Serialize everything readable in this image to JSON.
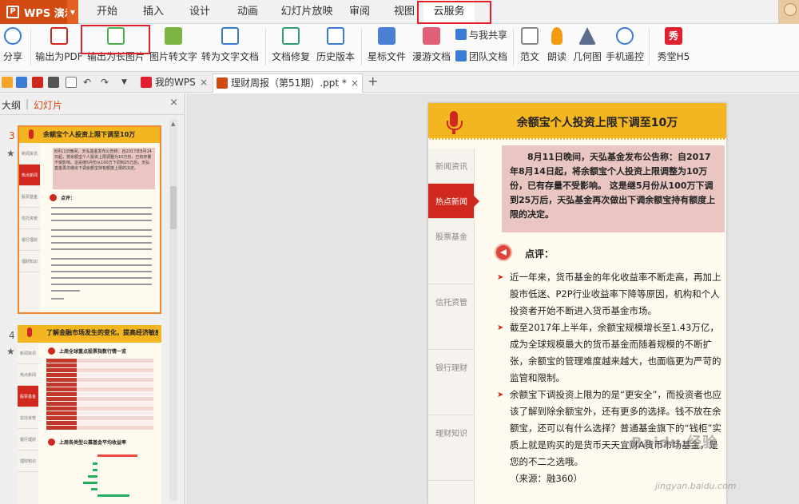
{
  "app": {
    "name": "WPS 演示",
    "logo": "P"
  },
  "menu": [
    "开始",
    "插入",
    "设计",
    "动画",
    "幻灯片放映",
    "审阅",
    "视图",
    "云服务"
  ],
  "ribbon": {
    "share": "分享",
    "export_pdf": "输出为PDF",
    "export_long_image": "输出为长图片",
    "image_to_text": "图片转文字",
    "convert_to_text": "转为文字文档",
    "doc_repair": "文档修复",
    "history": "历史版本",
    "starred": "星标文件",
    "roaming": "漫游文档",
    "share_with_me": "与我共享",
    "team_docs": "团队文档",
    "templates": "范文",
    "read_aloud": "朗读",
    "geometry": "几何图",
    "phone_remote": "手机遥控",
    "xiutang": "秀堂H5",
    "xiutang_logo": "秀"
  },
  "tabs": {
    "my_wps": "我的WPS",
    "doc": "理财周报（第51期）.ppt *",
    "close": "×",
    "add": "+"
  },
  "left_panel": {
    "outline_tab": "大纲",
    "slides_tab": "幻灯片",
    "divider": "|",
    "close": "×",
    "slide3_num": "3",
    "slide4_num": "4",
    "star": "★",
    "thumb3": {
      "title": "余额宝个人投资上限下调至10万",
      "nav": [
        "新闻资讯",
        "热点新闻",
        "股票基金",
        "信托资管",
        "银行理财",
        "理财知识"
      ],
      "pink": "8月11日晚间，天弘基金发布公告称：自2017年8月14日起，将余额宝个人投资上限调整为10万份，已有存量不受影响。这是继5月份从100万下调到25万后，天弘基金再次做出下调余额宝持有额度上限的决定。",
      "comment": "点评："
    },
    "thumb4": {
      "title": "了解金融市场发生的变化，提高经济敏感度",
      "nav": [
        "新闻资讯",
        "热点新闻",
        "股票基金",
        "信托资管",
        "银行理财",
        "理财知识"
      ],
      "sub1": "上周全球重点股票指数行情一览",
      "sub2": "上周各类型公募基金平均收益率"
    }
  },
  "slide": {
    "title": "余额宝个人投资上限下调至10万",
    "nav": [
      "新闻资讯",
      "热点新闻",
      "股票基金",
      "信托资管",
      "银行理财",
      "理财知识"
    ],
    "highlight": "8月11日晚间，天弘基金发布公告称：自2017年8月14日起，将余额宝个人投资上限调整为10万份，已有存量不受影响。 这是继5月份从100万下调到25万后，天弘基金再次做出下调余额宝持有额度上限的决定。",
    "comment_label": "点评：",
    "bullets": [
      "近一年来，货币基金的年化收益率不断走高，再加上股市低迷、P2P行业收益率下降等原因，机构和个人投资者开始不断进入货币基金市场。",
      "截至2017年上半年，余额宝规模增长至1.43万亿，成为全球规模最大的货币基金而随着规模的不断扩张，余额宝的管理难度越来越大，也面临更为严苛的监管和限制。",
      "余额宝下调投资上限为的是“更安全”，而投资者也应该了解到除余额宝外，还有更多的选择。钱不放在余额宝，还可以有什么选择？普通基金旗下的“钱柜”实质上就是购买的是货币天天宜财A货币市场基金，是您的不二之选哦。"
    ],
    "source": "（来源：融360）"
  },
  "watermark": {
    "text": "Baidu 经验",
    "url": "jingyan.baidu.com"
  },
  "colors": {
    "accent": "#d04a12",
    "highlight_box": "#e3202a",
    "slide_header": "#f3b520",
    "hot_nav": "#d0271e",
    "pink_box": "#e9c6c2"
  }
}
